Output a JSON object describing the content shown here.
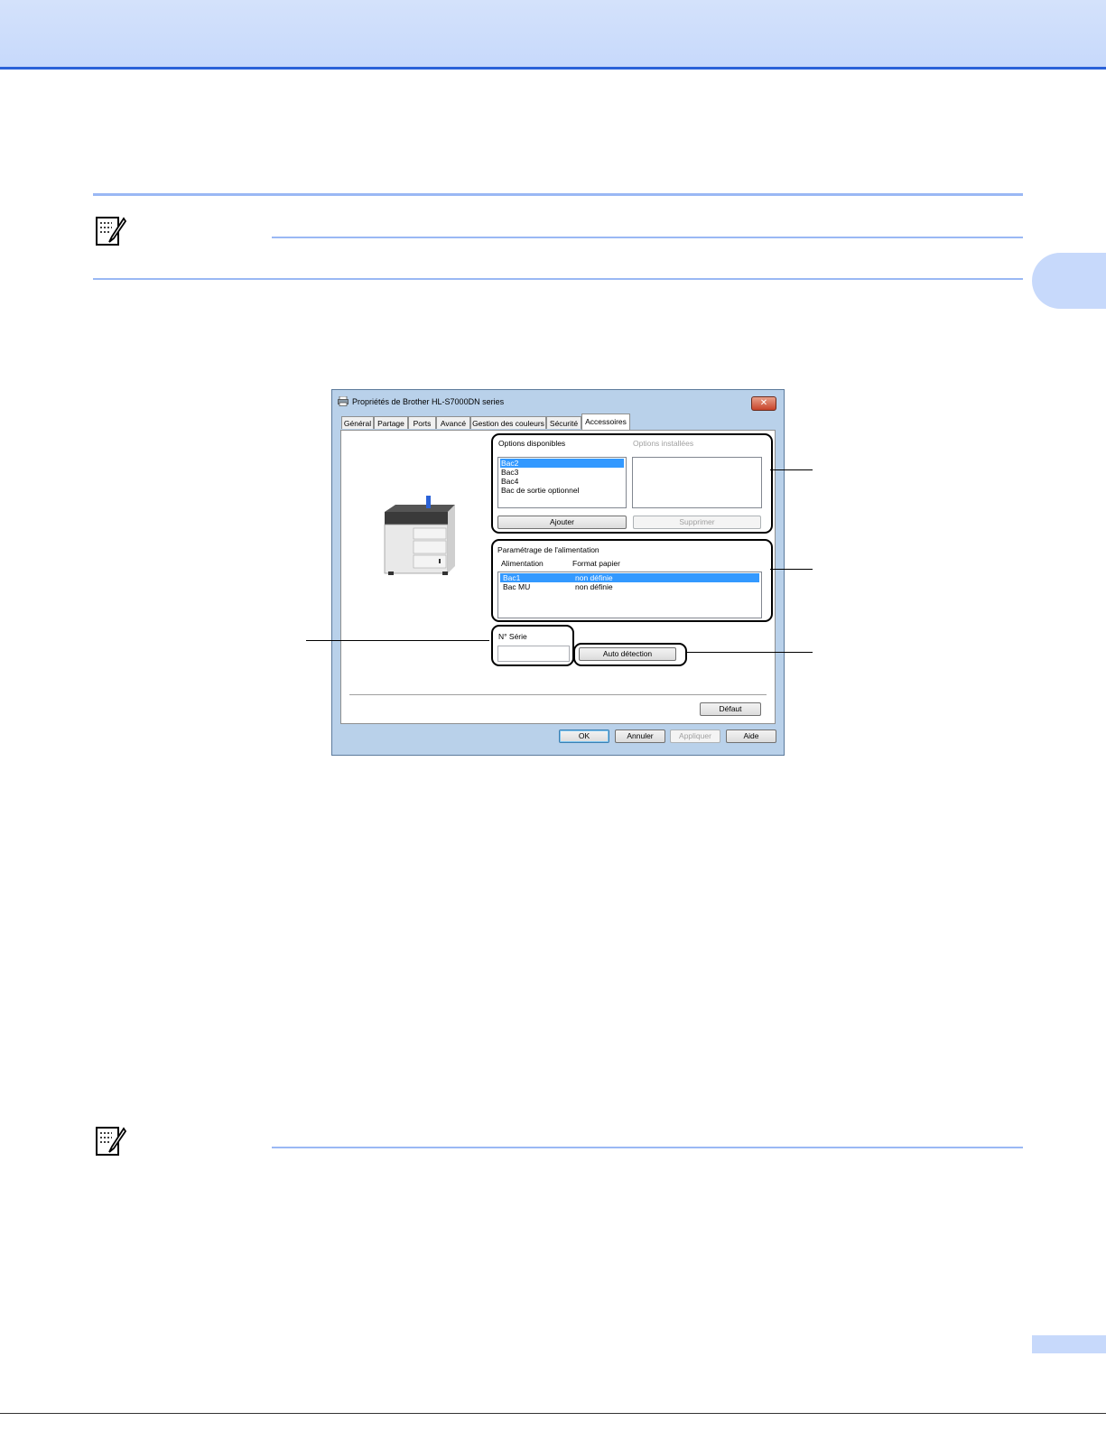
{
  "dialog": {
    "title": "Propriétés de Brother HL-S7000DN series",
    "close_glyph": "✕",
    "tabs": [
      {
        "label": "Général"
      },
      {
        "label": "Partage"
      },
      {
        "label": "Ports"
      },
      {
        "label": "Avancé"
      },
      {
        "label": "Gestion des couleurs"
      },
      {
        "label": "Sécurité"
      },
      {
        "label": "Accessoires"
      }
    ],
    "options": {
      "available_label": "Options disponibles",
      "installed_label": "Options installées",
      "available_items": [
        "Bac2",
        "Bac3",
        "Bac4",
        "Bac de sortie optionnel"
      ],
      "add_button": "Ajouter",
      "remove_button": "Supprimer"
    },
    "source": {
      "group_label": "Paramétrage de l'alimentation",
      "col_source": "Alimentation",
      "col_size": "Format papier",
      "rows": [
        {
          "source": "Bac1",
          "size": "non définie"
        },
        {
          "source": "Bac MU",
          "size": "non définie"
        }
      ]
    },
    "serial": {
      "label": "N° Série",
      "value": ""
    },
    "auto_detect_button": "Auto détection",
    "default_button": "Défaut",
    "footer_buttons": {
      "ok": "OK",
      "cancel": "Annuler",
      "apply": "Appliquer",
      "help": "Aide"
    }
  },
  "colors": {
    "header_band": "#c7d9fb",
    "accent_rule": "#2b62d8",
    "selection": "#3399ff"
  }
}
